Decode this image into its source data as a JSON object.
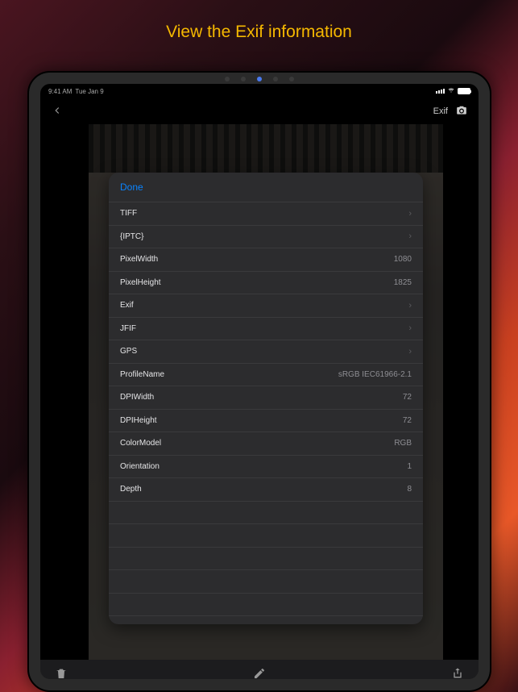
{
  "promo": {
    "title": "View the Exif information"
  },
  "statusBar": {
    "time": "9:41 AM",
    "date": "Tue Jan 9"
  },
  "navBar": {
    "exifLabel": "Exif"
  },
  "exifPanel": {
    "doneLabel": "Done",
    "rows": [
      {
        "key": "TIFF",
        "value": "",
        "chevron": true
      },
      {
        "key": "{IPTC}",
        "value": "",
        "chevron": true
      },
      {
        "key": "PixelWidth",
        "value": "1080",
        "chevron": false
      },
      {
        "key": "PixelHeight",
        "value": "1825",
        "chevron": false
      },
      {
        "key": "Exif",
        "value": "",
        "chevron": true
      },
      {
        "key": "JFIF",
        "value": "",
        "chevron": true
      },
      {
        "key": "GPS",
        "value": "",
        "chevron": true
      },
      {
        "key": "ProfileName",
        "value": "sRGB IEC61966-2.1",
        "chevron": false
      },
      {
        "key": "DPIWidth",
        "value": "72",
        "chevron": false
      },
      {
        "key": "DPIHeight",
        "value": "72",
        "chevron": false
      },
      {
        "key": "ColorModel",
        "value": "RGB",
        "chevron": false
      },
      {
        "key": "Orientation",
        "value": "1",
        "chevron": false
      },
      {
        "key": "Depth",
        "value": "8",
        "chevron": false
      }
    ]
  }
}
